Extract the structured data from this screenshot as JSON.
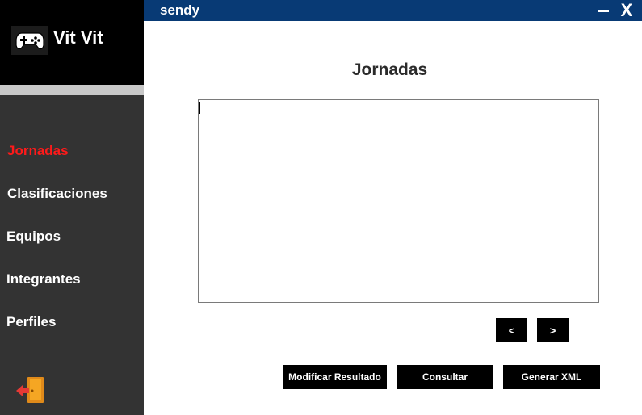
{
  "brand": {
    "name": "Vit Vit",
    "logo_icon": "gamepad-icon"
  },
  "titlebar": {
    "user": "sendy",
    "minimize_label": "–",
    "close_label": "X",
    "background": "#083a75"
  },
  "sidebar": {
    "items": [
      {
        "label": "Jornadas",
        "active": true
      },
      {
        "label": "Clasificaciones",
        "active": false
      },
      {
        "label": "Equipos",
        "active": false
      },
      {
        "label": "Integrantes",
        "active": false
      },
      {
        "label": "Perfiles",
        "active": false
      }
    ],
    "active_color": "#ff1a1a",
    "logout_icon": "logout-door-icon"
  },
  "main": {
    "title": "Jornadas",
    "results_text": "",
    "pagination": {
      "prev_label": "<",
      "next_label": ">"
    },
    "actions": {
      "modify_label": "Modificar Resultado",
      "query_label": "Consultar",
      "xml_label": "Generar XML"
    }
  }
}
